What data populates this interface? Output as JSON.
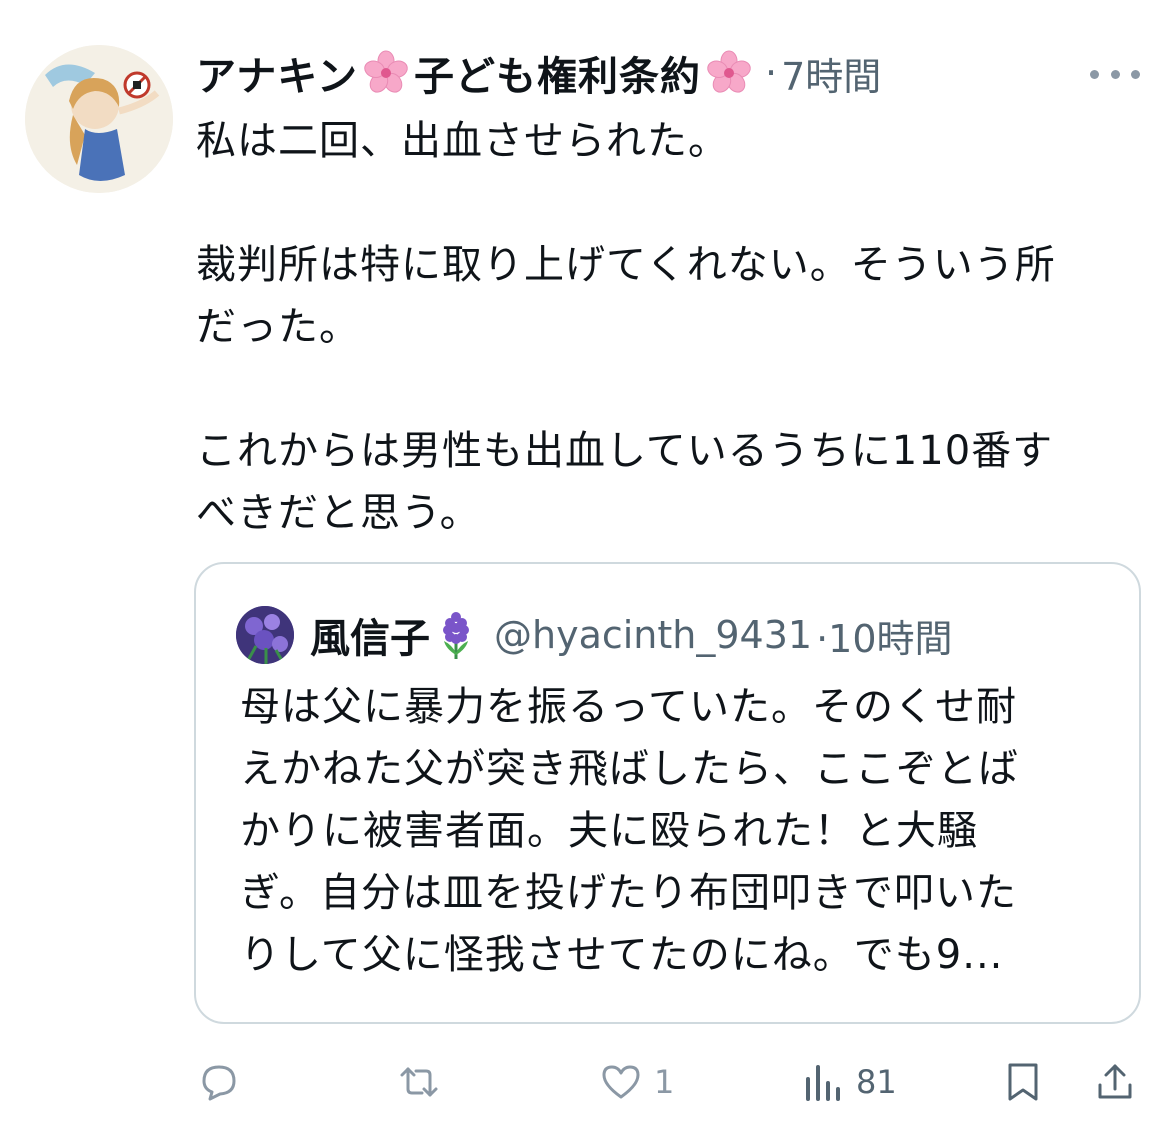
{
  "tweet": {
    "author_name": "アナキン",
    "author_name_mid": "子ども権利条約",
    "name_emoji": "cherry-blossom-icon",
    "separator": "·",
    "time": "7時間",
    "lines": [
      "私は二回、出血させられた。",
      "",
      "裁判所は特に取り上げてくれない。そういう所",
      "だった。",
      "",
      "これからは男性も出血しているうちに110番す",
      "べきだと思う。"
    ]
  },
  "quoted": {
    "name": "風信子",
    "name_emoji": "hyacinth-icon",
    "handle": "@hyacinth_9431",
    "time": "·10時間",
    "lines": [
      "母は父に暴力を振るっていた。そのくせ耐",
      "えかねた父が突き飛ばしたら、ここぞとば",
      "かりに被害者面。夫に殴られた！と大騒",
      "ぎ。自分は皿を投げたり布団叩きで叩いた",
      "りして父に怪我させてたのにね。でも9..."
    ]
  },
  "actions": {
    "reply_count": "",
    "retweet_count": "",
    "like_count": "1",
    "views_count": "81"
  },
  "colors": {
    "text": "#0f1419",
    "muted": "#536471",
    "icon": "#8b98a5",
    "border": "#cfd9de",
    "cherry": "#f7a8c9",
    "hyacinth": "#6b4fb5"
  }
}
